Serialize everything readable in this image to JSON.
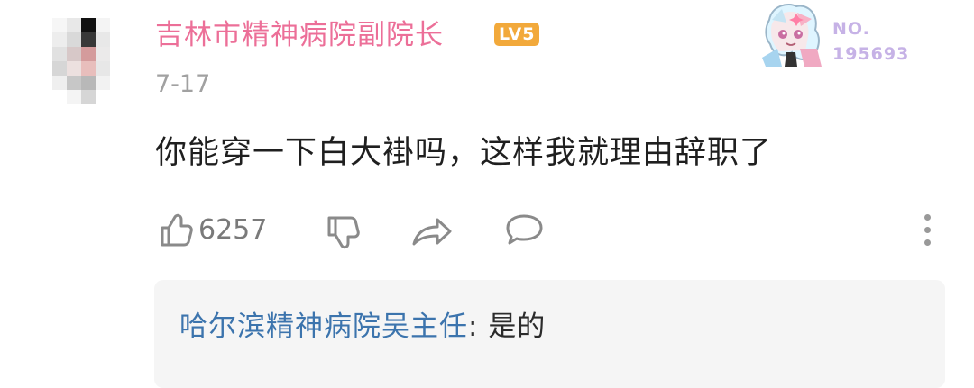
{
  "comment": {
    "username": "吉林市精神病院副院长",
    "level": "LV5",
    "date": "7-17",
    "text": "你能穿一下白大褂吗，这样我就理由辞职了",
    "like_count": "6257"
  },
  "fan_badge": {
    "label": "NO.",
    "number": "195693"
  },
  "reply": {
    "author": "哈尔滨精神病院吴主任",
    "separator": ":",
    "text": "是的"
  },
  "colors": {
    "username": "#ec6f98",
    "level_badge": "#f2a93b",
    "reply_author": "#3c74ad",
    "fan_badge_text": "#c6b2e6",
    "icon": "#8a8a8a"
  },
  "icons": [
    "thumbs-up-icon",
    "thumbs-down-icon",
    "share-icon",
    "comment-icon",
    "more-vertical-icon"
  ]
}
